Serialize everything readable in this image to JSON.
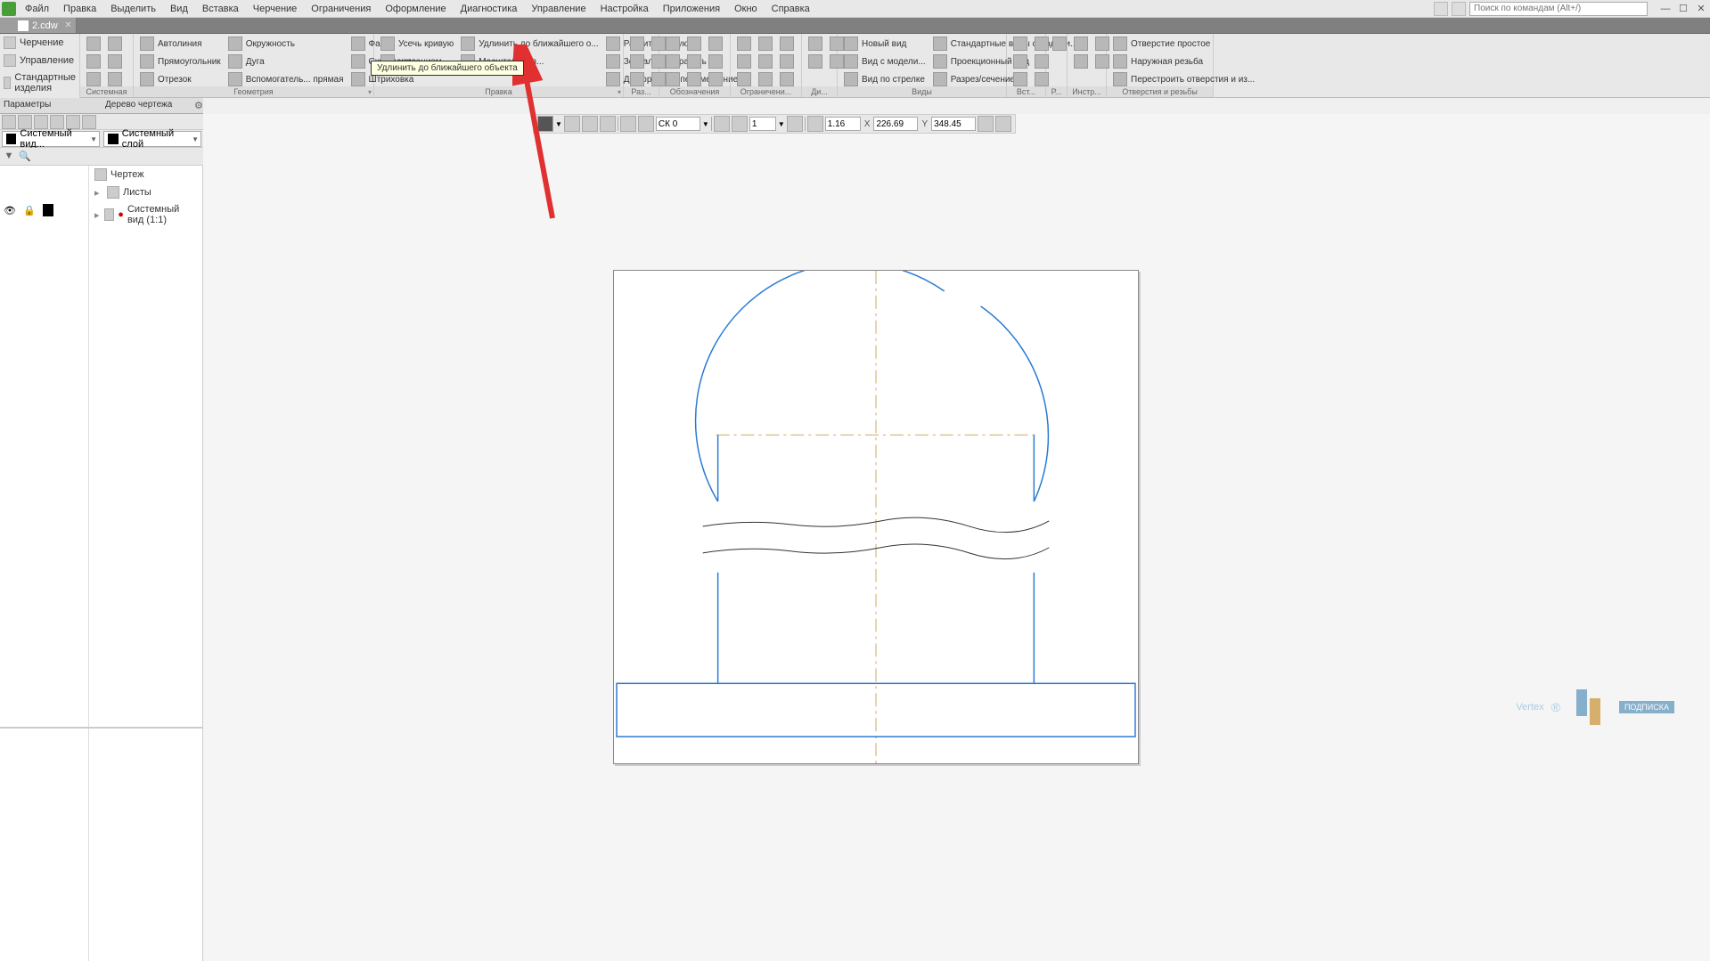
{
  "menu": {
    "items": [
      "Файл",
      "Правка",
      "Выделить",
      "Вид",
      "Вставка",
      "Черчение",
      "Ограничения",
      "Оформление",
      "Диагностика",
      "Управление",
      "Настройка",
      "Приложения",
      "Окно",
      "Справка"
    ],
    "search_placeholder": "Поиск по командам (Alt+/)"
  },
  "tab": {
    "name": "2.cdw"
  },
  "left_panel": {
    "items": [
      "Черчение",
      "Управление",
      "Стандартные изделия"
    ]
  },
  "ribbon": {
    "groups": {
      "system": {
        "label": "Системная"
      },
      "geometry": {
        "label": "Геометрия",
        "items": [
          "Автолиния",
          "Прямоугольник",
          "Отрезок",
          "Окружность",
          "Дуга",
          "Вспомогатель... прямая",
          "Фаска",
          "Скругление",
          "Штриховка"
        ]
      },
      "edit": {
        "label": "Правка",
        "items": [
          "Усечь кривую",
          "Удлинить до ближайшего о...",
          "Разбить кривую",
          "Зеркально отразить",
          "Деформация перемещением",
          "Масштабиров...",
          "указанием"
        ]
      },
      "dim": {
        "label": "Раз..."
      },
      "designations": {
        "label": "Обозначения"
      },
      "constraints": {
        "label": "Ограничени..."
      },
      "diag": {
        "label": "Ди..."
      },
      "views": {
        "label": "Виды",
        "items": [
          "Новый вид",
          "Вид с модели...",
          "Вид по стрелке",
          "Стандартные виды с модели...",
          "Проекционный вид",
          "Разрез/сечение"
        ]
      },
      "insert": {
        "label": "Вст..."
      },
      "r": {
        "label": "Р..."
      },
      "instr": {
        "label": "Инстр..."
      },
      "holes": {
        "label": "Отверстия и резьбы",
        "items": [
          "Отверстие простое",
          "Наружная резьба",
          "Перестроить отверстия и из..."
        ]
      }
    }
  },
  "panels": {
    "params": "Параметры",
    "tree": "Дерево чертежа"
  },
  "layers": {
    "view": "Системный вид...",
    "layer": "Системный слой"
  },
  "tree": {
    "root": "Чертеж",
    "sheets": "Листы",
    "system_view": "Системный вид (1:1)"
  },
  "tooltip": "Удлинить до ближайшего объекта",
  "status_bar": {
    "ck": "СК 0",
    "scale": "1",
    "zoom": "1.16",
    "x_label": "X",
    "x": "226.69",
    "y_label": "Y",
    "y": "348.45"
  },
  "watermark": {
    "brand": "Vertex",
    "badge": "ПОДПИСКА"
  }
}
